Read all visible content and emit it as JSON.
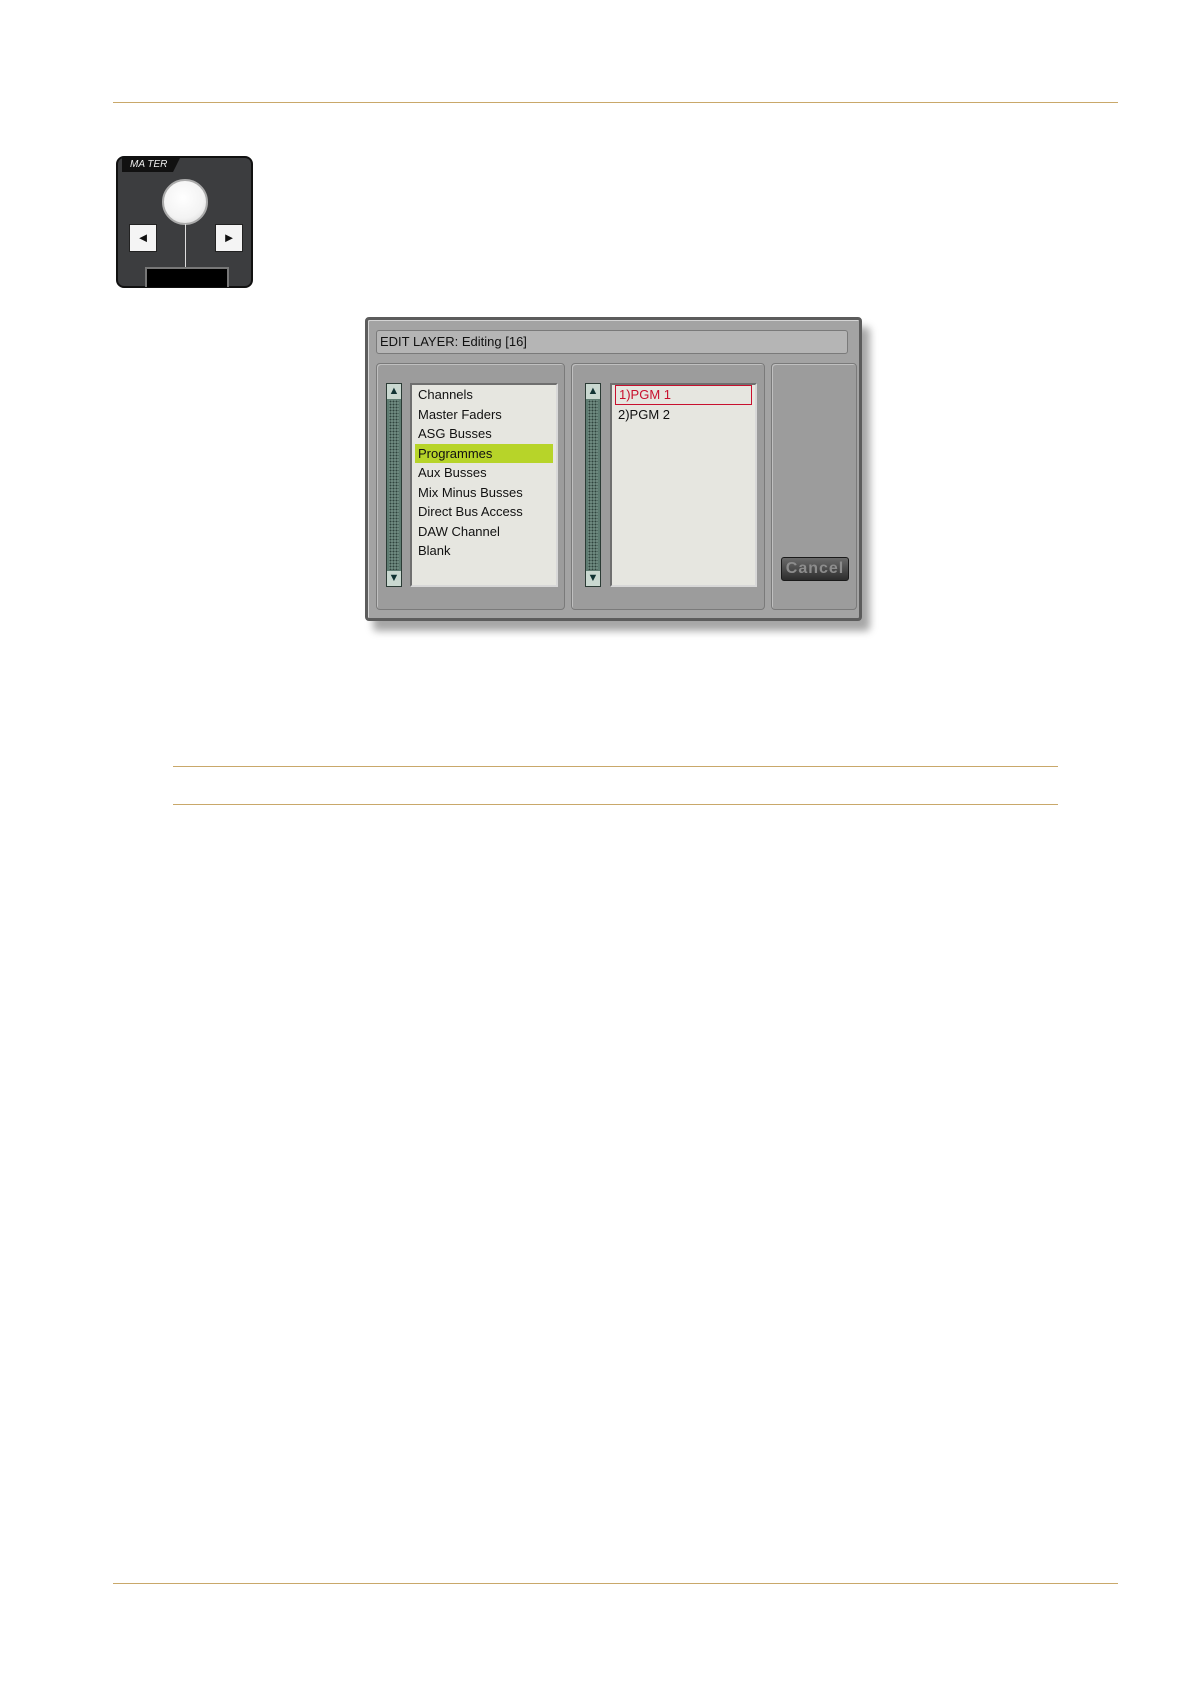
{
  "master_panel": {
    "label": "MA  TER",
    "left_arrow": "◄",
    "right_arrow": "►"
  },
  "dialog": {
    "title": "EDIT LAYER: Editing [16]",
    "left_list": {
      "items": [
        "Channels",
        "Master Faders",
        "ASG Busses",
        "Programmes",
        "Aux Busses",
        "Mix Minus Busses",
        "Direct Bus Access",
        "DAW Channel",
        "Blank"
      ],
      "selected": "Programmes"
    },
    "right_list": {
      "items": [
        "1)PGM 1",
        "2)PGM 2"
      ],
      "selected": "1)PGM 1"
    },
    "scroll_up": "▲",
    "scroll_down": "▼",
    "cancel_label": "Cancel"
  },
  "colors": {
    "rule": "#c9a86a",
    "selection_highlight": "#b7d429",
    "pgm_selected": "#c8102e"
  }
}
